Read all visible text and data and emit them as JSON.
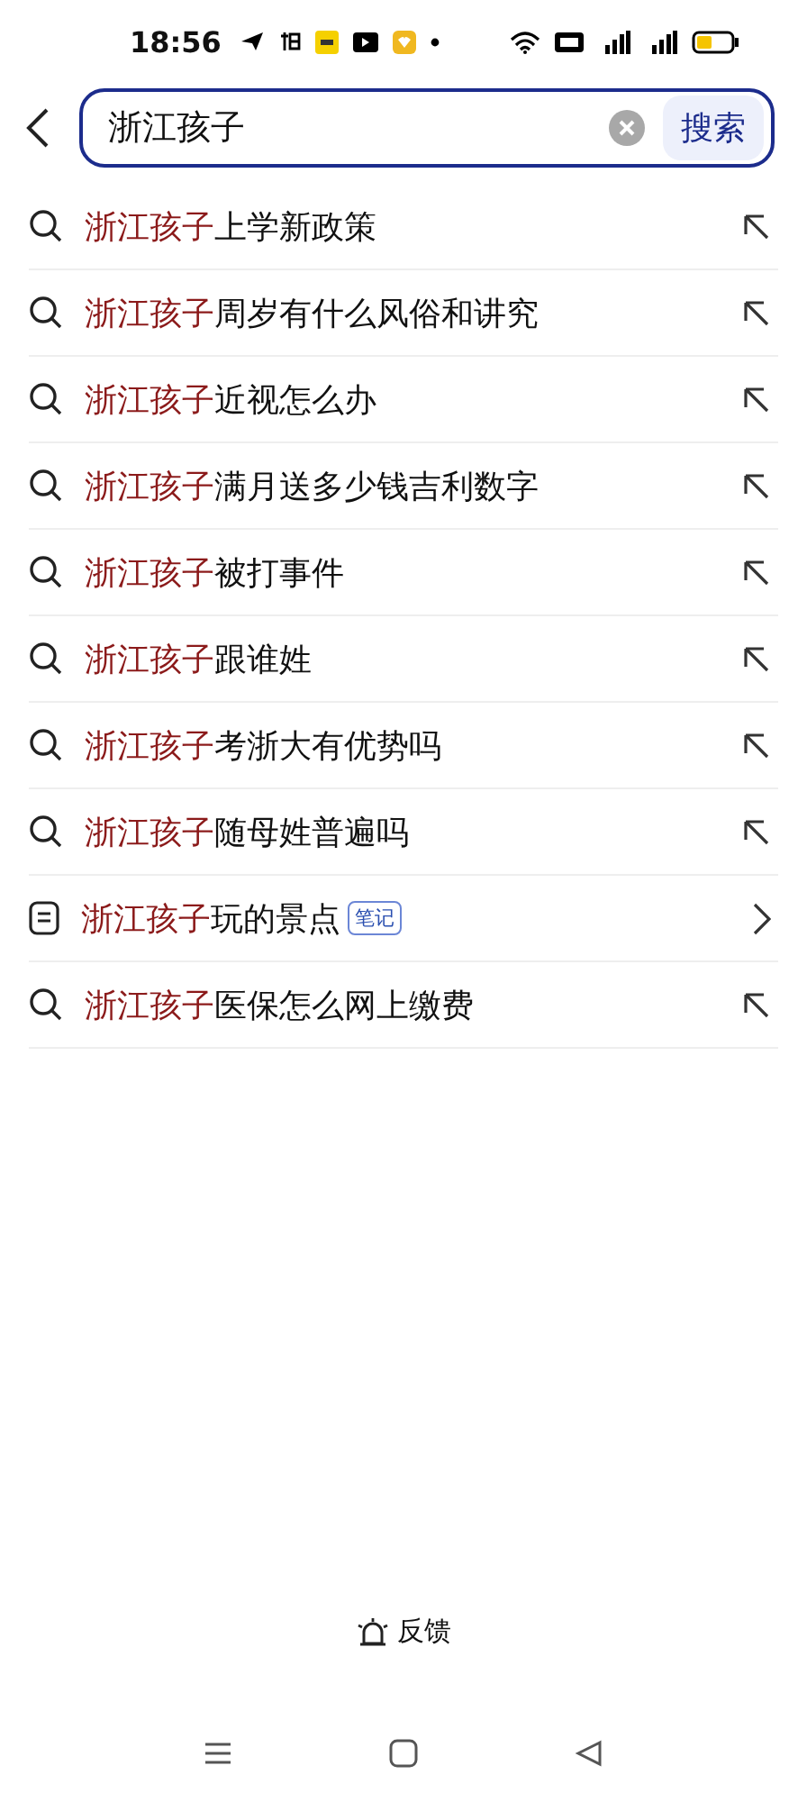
{
  "status_bar": {
    "time": "18:56"
  },
  "search": {
    "value": "浙江孩子",
    "button": "搜索"
  },
  "suggestions": [
    {
      "kind": "search",
      "match": "浙江孩子",
      "rest": "上学新政策"
    },
    {
      "kind": "search",
      "match": "浙江孩子",
      "rest": "周岁有什么风俗和讲究"
    },
    {
      "kind": "search",
      "match": "浙江孩子",
      "rest": "近视怎么办"
    },
    {
      "kind": "search",
      "match": "浙江孩子",
      "rest": "满月送多少钱吉利数字"
    },
    {
      "kind": "search",
      "match": "浙江孩子",
      "rest": "被打事件"
    },
    {
      "kind": "search",
      "match": "浙江孩子",
      "rest": "跟谁姓"
    },
    {
      "kind": "search",
      "match": "浙江孩子",
      "rest": "考浙大有优势吗"
    },
    {
      "kind": "search",
      "match": "浙江孩子",
      "rest": "随母姓普遍吗"
    },
    {
      "kind": "note",
      "match": "浙江孩子",
      "rest": "玩的景点",
      "tag": "笔记"
    },
    {
      "kind": "search",
      "match": "浙江孩子",
      "rest": "医保怎么网上缴费"
    }
  ],
  "feedback": "反馈"
}
